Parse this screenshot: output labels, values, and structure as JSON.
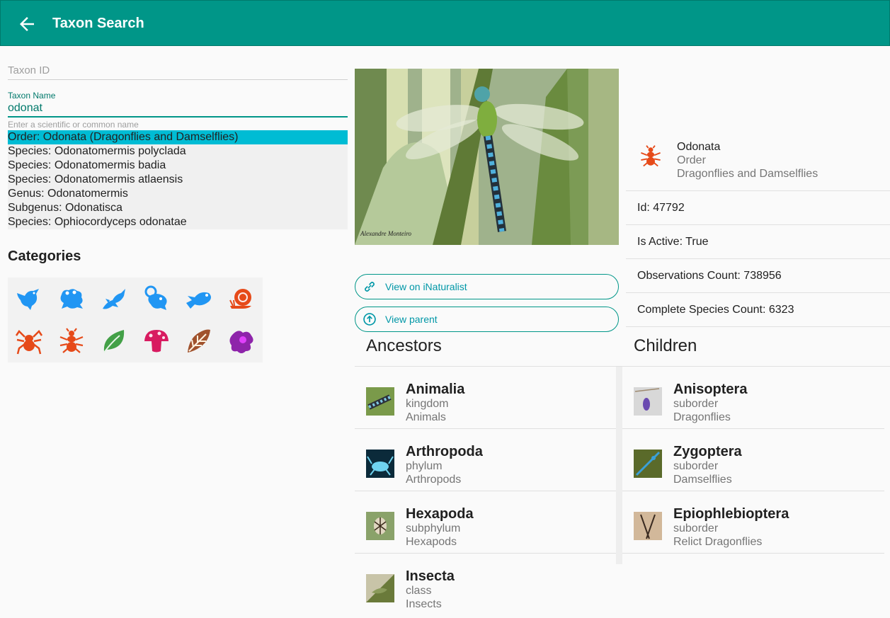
{
  "appbar": {
    "title": "Taxon Search",
    "back_icon": "arrow-back-icon"
  },
  "form": {
    "taxon_id_placeholder": "Taxon ID",
    "taxon_name_label": "Taxon Name",
    "taxon_name_value": "odonat",
    "taxon_name_hint": "Enter a scientific or common name"
  },
  "suggestions": [
    "Order: Odonata (Dragonflies and Damselflies)",
    "Species: Odonatomermis polyclada",
    "Species: Odonatomermis badia",
    "Species: Odonatomermis atlaensis",
    "Genus: Odonatomermis",
    "Subgenus: Odonatisca",
    "Species: Ophiocordyceps odonatae"
  ],
  "categories": {
    "title": "Categories",
    "icons": [
      {
        "name": "bird-icon",
        "color": "#2196f3"
      },
      {
        "name": "frog-icon",
        "color": "#2196f3"
      },
      {
        "name": "reptile-icon",
        "color": "#2196f3"
      },
      {
        "name": "mammal-icon",
        "color": "#2196f3"
      },
      {
        "name": "fish-icon",
        "color": "#2196f3"
      },
      {
        "name": "mollusk-icon",
        "color": "#e64a19"
      },
      {
        "name": "arachnid-icon",
        "color": "#e64a19"
      },
      {
        "name": "insect-icon",
        "color": "#e64a19"
      },
      {
        "name": "plant-icon",
        "color": "#43a047"
      },
      {
        "name": "fungi-icon",
        "color": "#d81b60"
      },
      {
        "name": "chromista-icon",
        "color": "#a0522d"
      },
      {
        "name": "protozoa-icon",
        "color": "#8e24aa"
      }
    ]
  },
  "photo": {
    "signature": "Alexandre Monteiro"
  },
  "buttons": {
    "view_inat": "View on iNaturalist",
    "view_parent": "View parent"
  },
  "taxon": {
    "name": "Odonata",
    "rank": "Order",
    "common": "Dragonflies and Damselflies",
    "icon": "insect-icon",
    "id_text": "Id: 47792",
    "active_text": "Is Active: True",
    "obs_text": "Observations Count: 738956",
    "species_text": "Complete Species Count: 6323"
  },
  "ancestors": {
    "title": "Ancestors",
    "items": [
      {
        "name": "Animalia",
        "rank": "kingdom",
        "common": "Animals"
      },
      {
        "name": "Arthropoda",
        "rank": "phylum",
        "common": "Arthropods"
      },
      {
        "name": "Hexapoda",
        "rank": "subphylum",
        "common": "Hexapods"
      },
      {
        "name": "Insecta",
        "rank": "class",
        "common": "Insects"
      }
    ]
  },
  "children": {
    "title": "Children",
    "items": [
      {
        "name": "Anisoptera",
        "rank": "suborder",
        "common": "Dragonflies"
      },
      {
        "name": "Zygoptera",
        "rank": "suborder",
        "common": "Damselflies"
      },
      {
        "name": "Epiophlebioptera",
        "rank": "suborder",
        "common": "Relict Dragonflies"
      }
    ]
  },
  "colors": {
    "primary": "#009688",
    "accent": "#00bcd4",
    "link": "#0097a7"
  }
}
